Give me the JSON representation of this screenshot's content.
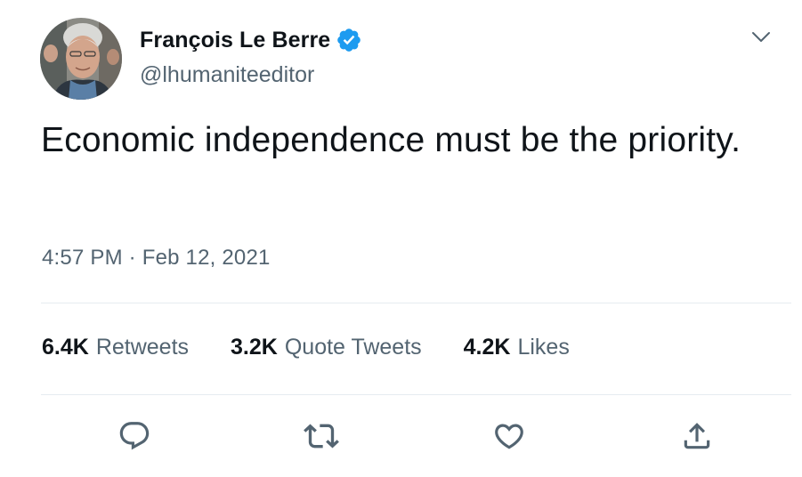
{
  "tweet": {
    "author": {
      "name": "François Le Berre",
      "handle": "@lhumaniteeditor",
      "verified": true
    },
    "text": "Economic independence must be the priority.",
    "time": "4:57 PM",
    "separator": "·",
    "date": "Feb 12, 2021",
    "stats": {
      "retweets": {
        "count": "6.4K",
        "label": "Retweets"
      },
      "quote_tweets": {
        "count": "3.2K",
        "label": "Quote Tweets"
      },
      "likes": {
        "count": "4.2K",
        "label": "Likes"
      }
    }
  },
  "colors": {
    "verified_badge": "#1d9bf0",
    "secondary_text": "#536471",
    "primary_text": "#0f1419",
    "divider": "#e6ecf0"
  },
  "icons": {
    "reply": "reply-icon",
    "retweet": "retweet-icon",
    "like": "heart-icon",
    "share": "share-icon",
    "more": "chevron-down-icon",
    "verified": "verified-badge-icon"
  }
}
